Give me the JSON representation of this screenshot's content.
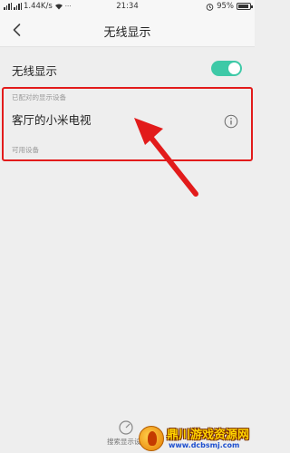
{
  "status_bar": {
    "net_speed": "1.44K/s",
    "time": "21:34",
    "battery": "95%"
  },
  "header": {
    "title": "无线显示"
  },
  "wireless_toggle": {
    "label": "无线显示",
    "enabled": true
  },
  "paired_section": {
    "header": "已配对的显示设备",
    "devices": [
      {
        "name": "客厅的小米电视"
      }
    ]
  },
  "available_section": {
    "header": "可用设备"
  },
  "bottom_bar": {
    "search_label": "搜索显示设备"
  },
  "watermark": {
    "title": "鼎川游戏资源网",
    "url": "www.dcbsmj.com"
  },
  "colors": {
    "toggle_on": "#3ec9a7",
    "highlight": "#e21b1b",
    "background": "#eeeeee"
  }
}
